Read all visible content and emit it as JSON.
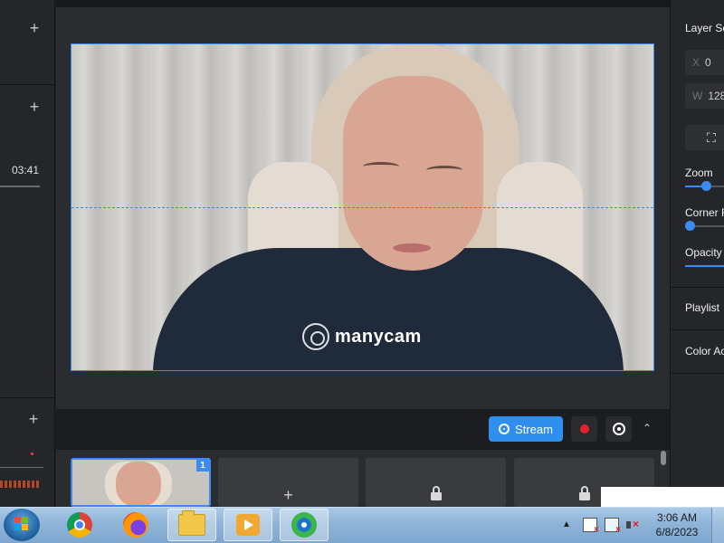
{
  "left_panel": {
    "time": "03:41"
  },
  "preview": {
    "watermark": "manycam"
  },
  "controls": {
    "stream_label": "Stream"
  },
  "presets": {
    "active_badge": "1"
  },
  "right_panel": {
    "layer_title": "Layer Se",
    "x_label": "X",
    "x_value": "0",
    "w_label": "W",
    "w_value": "128",
    "zoom_label": "Zoom",
    "corner_label": "Corner R",
    "opacity_label": "Opacity",
    "playlist_label": "Playlist",
    "color_label": "Color Ac",
    "sliders": {
      "zoom": 0.38,
      "corner": 0.0,
      "opacity": 1.0
    }
  },
  "taskbar": {
    "time": "3:06 AM",
    "date": "6/8/2023"
  },
  "colors": {
    "accent": "#3d8bf0",
    "record": "#e0242b",
    "stream_button": "#2f8fef"
  },
  "icons": [
    "plus-icon",
    "stream-icon",
    "record-icon",
    "snapshot-icon",
    "chevron-up-icon",
    "lock-icon",
    "crop-icon",
    "windows-start-icon",
    "chrome-icon",
    "firefox-icon",
    "folder-icon",
    "media-player-icon",
    "manycam-icon",
    "action-center-icon",
    "network-icon",
    "volume-icon"
  ]
}
